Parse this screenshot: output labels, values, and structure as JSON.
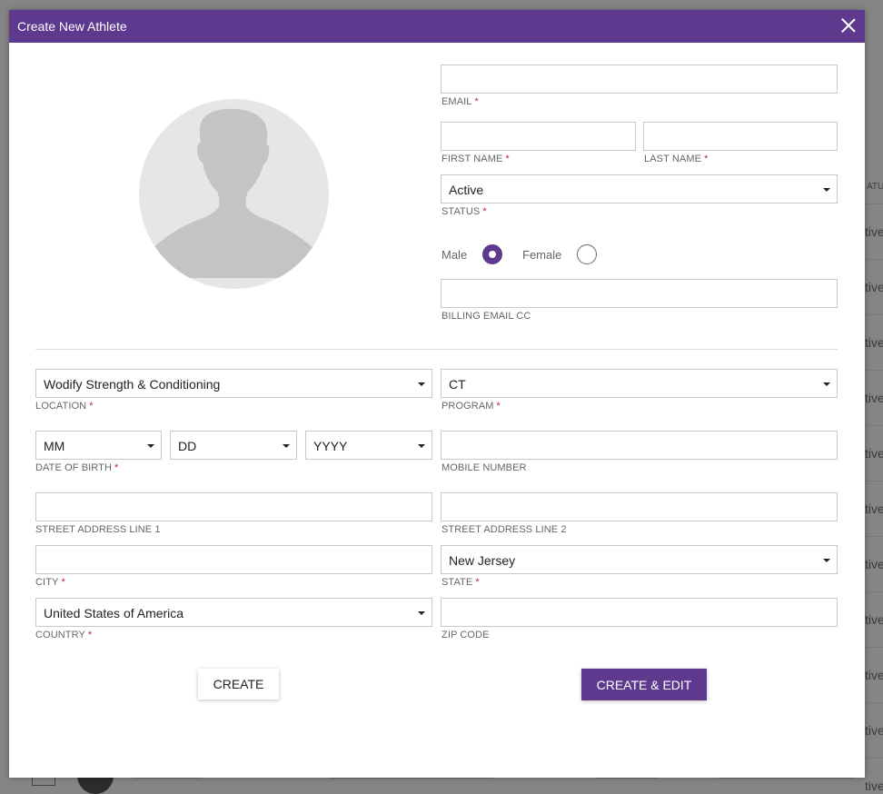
{
  "modal": {
    "title": "Create New Athlete"
  },
  "fields": {
    "email": {
      "label": "EMAIL",
      "value": "",
      "required": "*"
    },
    "first_name": {
      "label": "FIRST NAME",
      "value": "",
      "required": "*"
    },
    "last_name": {
      "label": "LAST NAME",
      "value": "",
      "required": "*"
    },
    "status": {
      "label": "STATUS",
      "value": "Active",
      "required": "*"
    },
    "billing_email_cc": {
      "label": "BILLING EMAIL CC",
      "value": ""
    },
    "location": {
      "label": "LOCATION",
      "value": "Wodify Strength & Conditioning",
      "required": "*"
    },
    "program": {
      "label": "PROGRAM",
      "value": "CT",
      "required": "*"
    },
    "dob": {
      "label": "DATE OF BIRTH",
      "required": "*",
      "month": "MM",
      "day": "DD",
      "year": "YYYY"
    },
    "mobile_number": {
      "label": "MOBILE NUMBER",
      "value": ""
    },
    "street1": {
      "label": "STREET ADDRESS LINE 1",
      "value": ""
    },
    "street2": {
      "label": "STREET ADDRESS LINE 2",
      "value": ""
    },
    "city": {
      "label": "CITY",
      "value": "",
      "required": "*"
    },
    "state": {
      "label": "STATE",
      "value": "New Jersey",
      "required": "*"
    },
    "country": {
      "label": "COUNTRY",
      "value": "United States of America",
      "required": "*"
    },
    "zip_code": {
      "label": "ZIP CODE",
      "value": ""
    }
  },
  "gender": {
    "male_label": "Male",
    "female_label": "Female",
    "selected": "Male"
  },
  "buttons": {
    "create": "CREATE",
    "create_edit": "CREATE & EDIT"
  },
  "background": {
    "status_column_fragment": "ATUS",
    "row_status_fragment": "tive",
    "row_count": 11
  },
  "colors": {
    "accent": "#5d3a8e",
    "required": "#c0262d",
    "overlay": "#858585"
  },
  "icons": {
    "close": "close-icon",
    "avatar": "user-silhouette-icon",
    "dropdown": "caret-down-icon"
  }
}
